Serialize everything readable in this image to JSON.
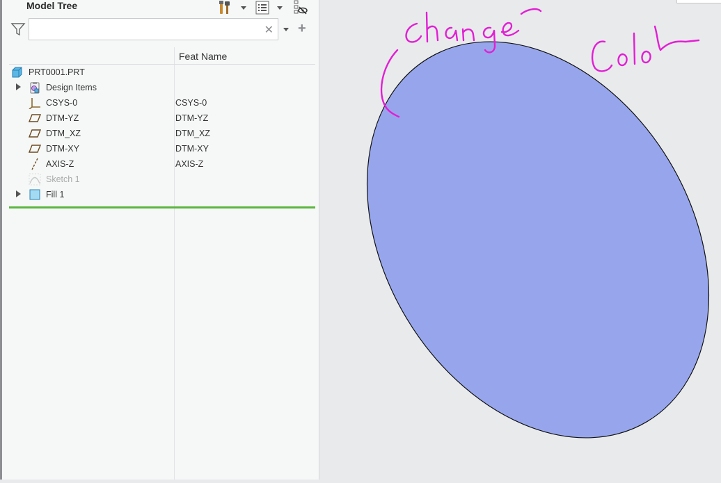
{
  "panel": {
    "title": "Model Tree",
    "search": {
      "value": "",
      "placeholder": ""
    },
    "column_header": "Feat Name"
  },
  "tree": {
    "root": {
      "label": "PRT0001.PRT"
    },
    "items": [
      {
        "label": "Design Items",
        "feat": "",
        "expandable": true
      },
      {
        "label": "CSYS-0",
        "feat": "CSYS-0"
      },
      {
        "label": "DTM-YZ",
        "feat": "DTM-YZ"
      },
      {
        "label": "DTM_XZ",
        "feat": "DTM_XZ"
      },
      {
        "label": "DTM-XY",
        "feat": "DTM-XY"
      },
      {
        "label": "AXIS-Z",
        "feat": "AXIS-Z"
      },
      {
        "label": "Sketch 1",
        "feat": "",
        "dimmed": true
      },
      {
        "label": "Fill 1",
        "feat": "",
        "expandable": true
      }
    ]
  },
  "icons": {
    "toolbar": [
      "tools-icon",
      "list-settings-icon",
      "hide-icon"
    ],
    "filter": "filter-icon",
    "clear": "clear-icon",
    "add": "add-icon"
  },
  "viewport": {
    "fill_color": "#97a6ec",
    "outline_color": "#111111",
    "annotation_color": "#e21fd4",
    "annotation_words": [
      "Change",
      "Color"
    ]
  }
}
